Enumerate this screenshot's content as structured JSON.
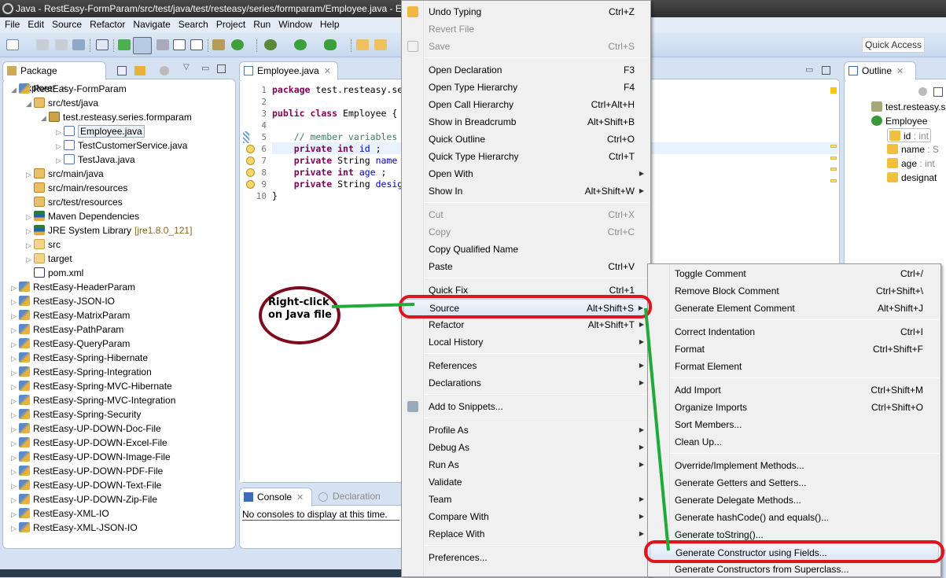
{
  "window": {
    "title": "Java - RestEasy-FormParam/src/test/java/test/resteasy/series/formparam/Employee.java - Eclipse"
  },
  "menubar": [
    "File",
    "Edit",
    "Source",
    "Refactor",
    "Navigate",
    "Search",
    "Project",
    "Run",
    "Window",
    "Help"
  ],
  "toolbar": {
    "quick_access_placeholder": "Quick Access"
  },
  "package_explorer": {
    "tab_label": "Package Explorer",
    "items": [
      {
        "label": "RestEasy-FormParam",
        "type": "project",
        "expanded": true
      },
      {
        "label": "src/test/java",
        "type": "source-folder",
        "expanded": true
      },
      {
        "label": "test.resteasy.series.formparam",
        "type": "package",
        "expanded": true
      },
      {
        "label": "Employee.java",
        "type": "java",
        "selected": true
      },
      {
        "label": "TestCustomerService.java",
        "type": "java"
      },
      {
        "label": "TestJava.java",
        "type": "java"
      },
      {
        "label": "src/main/java",
        "type": "source-folder"
      },
      {
        "label": "src/main/resources",
        "type": "source-folder"
      },
      {
        "label": "src/test/resources",
        "type": "source-folder"
      },
      {
        "label": "Maven Dependencies",
        "type": "library"
      },
      {
        "label": "JRE System Library",
        "suffix": "[jre1.8.0_121]",
        "type": "library"
      },
      {
        "label": "src",
        "type": "folder"
      },
      {
        "label": "target",
        "type": "folder"
      },
      {
        "label": "pom.xml",
        "type": "pom"
      },
      {
        "label": "RestEasy-HeaderParam",
        "type": "project"
      },
      {
        "label": "RestEasy-JSON-IO",
        "type": "project"
      },
      {
        "label": "RestEasy-MatrixParam",
        "type": "project"
      },
      {
        "label": "RestEasy-PathParam",
        "type": "project"
      },
      {
        "label": "RestEasy-QueryParam",
        "type": "project"
      },
      {
        "label": "RestEasy-Spring-Hibernate",
        "type": "project"
      },
      {
        "label": "RestEasy-Spring-Integration",
        "type": "project"
      },
      {
        "label": "RestEasy-Spring-MVC-Hibernate",
        "type": "project"
      },
      {
        "label": "RestEasy-Spring-MVC-Integration",
        "type": "project"
      },
      {
        "label": "RestEasy-Spring-Security",
        "type": "project"
      },
      {
        "label": "RestEasy-UP-DOWN-Doc-File",
        "type": "project"
      },
      {
        "label": "RestEasy-UP-DOWN-Excel-File",
        "type": "project"
      },
      {
        "label": "RestEasy-UP-DOWN-Image-File",
        "type": "project"
      },
      {
        "label": "RestEasy-UP-DOWN-PDF-File",
        "type": "project"
      },
      {
        "label": "RestEasy-UP-DOWN-Text-File",
        "type": "project"
      },
      {
        "label": "RestEasy-UP-DOWN-Zip-File",
        "type": "project"
      },
      {
        "label": "RestEasy-XML-IO",
        "type": "project"
      },
      {
        "label": "RestEasy-XML-JSON-IO",
        "type": "project"
      }
    ]
  },
  "editor": {
    "tab_label": "Employee.java",
    "lines": [
      {
        "n": "1",
        "parts": [
          [
            "kw",
            "package"
          ],
          [
            "",
            "test.resteasy.se"
          ]
        ]
      },
      {
        "n": "2",
        "parts": []
      },
      {
        "n": "3",
        "parts": [
          [
            "kw",
            "public"
          ],
          [
            "",
            ""
          ],
          [
            "kw",
            "class"
          ],
          [
            "",
            "Employee {"
          ]
        ]
      },
      {
        "n": "4",
        "parts": []
      },
      {
        "n": "5",
        "parts": [
          [
            "cm",
            "    // member variables"
          ]
        ]
      },
      {
        "n": "6",
        "parts": [
          [
            "kw",
            "    private"
          ],
          [
            "kw",
            "int"
          ],
          [
            "fld",
            "id"
          ],
          [
            "",
            ";"
          ]
        ]
      },
      {
        "n": "7",
        "parts": [
          [
            "kw",
            "    private"
          ],
          [
            "",
            "String"
          ],
          [
            "fld",
            "name"
          ]
        ]
      },
      {
        "n": "8",
        "parts": [
          [
            "kw",
            "    private"
          ],
          [
            "kw",
            "int"
          ],
          [
            "fld",
            "age"
          ],
          [
            "",
            ";"
          ]
        ]
      },
      {
        "n": "9",
        "parts": [
          [
            "kw",
            "    private"
          ],
          [
            "",
            "String"
          ],
          [
            "fld",
            "desig"
          ]
        ]
      },
      {
        "n": "10",
        "parts": [
          [
            "",
            "}"
          ]
        ]
      }
    ]
  },
  "outline": {
    "tab_label": "Outline",
    "items": [
      {
        "label": "test.resteasy.s",
        "type": "package"
      },
      {
        "label": "Employee",
        "type": "class"
      },
      {
        "label": "id",
        "typ": " : int",
        "selected": true
      },
      {
        "label": "name",
        "typ": " : S"
      },
      {
        "label": "age",
        "typ": " : int"
      },
      {
        "label": "designat",
        "typ": ""
      }
    ]
  },
  "console": {
    "tabs": [
      "Console",
      "Declaration"
    ],
    "message": "No consoles to display at this time."
  },
  "context_menu": {
    "items": [
      {
        "label": "Undo Typing",
        "shortcut": "Ctrl+Z",
        "icon": "undo-icon"
      },
      {
        "label": "Revert File",
        "shortcut": "",
        "disabled": true
      },
      {
        "label": "Save",
        "shortcut": "Ctrl+S",
        "disabled": true,
        "icon": "save-icon"
      },
      {
        "sep": true
      },
      {
        "label": "Open Declaration",
        "shortcut": "F3"
      },
      {
        "label": "Open Type Hierarchy",
        "shortcut": "F4"
      },
      {
        "label": "Open Call Hierarchy",
        "shortcut": "Ctrl+Alt+H"
      },
      {
        "label": "Show in Breadcrumb",
        "shortcut": "Alt+Shift+B"
      },
      {
        "label": "Quick Outline",
        "shortcut": "Ctrl+O"
      },
      {
        "label": "Quick Type Hierarchy",
        "shortcut": "Ctrl+T"
      },
      {
        "label": "Open With",
        "shortcut": "",
        "submenu": true
      },
      {
        "label": "Show In",
        "shortcut": "Alt+Shift+W",
        "submenu": true
      },
      {
        "sep": true
      },
      {
        "label": "Cut",
        "shortcut": "Ctrl+X",
        "disabled": true
      },
      {
        "label": "Copy",
        "shortcut": "Ctrl+C",
        "disabled": true
      },
      {
        "label": "Copy Qualified Name",
        "shortcut": ""
      },
      {
        "label": "Paste",
        "shortcut": "Ctrl+V"
      },
      {
        "sep": true
      },
      {
        "label": "Quick Fix",
        "shortcut": "Ctrl+1"
      },
      {
        "label": "Source",
        "shortcut": "Alt+Shift+S",
        "submenu": true,
        "highlighted": true
      },
      {
        "label": "Refactor",
        "shortcut": "Alt+Shift+T",
        "submenu": true
      },
      {
        "label": "Local History",
        "shortcut": "",
        "submenu": true
      },
      {
        "sep": true
      },
      {
        "label": "References",
        "shortcut": "",
        "submenu": true
      },
      {
        "label": "Declarations",
        "shortcut": "",
        "submenu": true
      },
      {
        "sep": true
      },
      {
        "label": "Add to Snippets...",
        "shortcut": "",
        "icon": "snippets-icon"
      },
      {
        "sep": true
      },
      {
        "label": "Profile As",
        "shortcut": "",
        "submenu": true
      },
      {
        "label": "Debug As",
        "shortcut": "",
        "submenu": true
      },
      {
        "label": "Run As",
        "shortcut": "",
        "submenu": true
      },
      {
        "label": "Validate",
        "shortcut": ""
      },
      {
        "label": "Team",
        "shortcut": "",
        "submenu": true
      },
      {
        "label": "Compare With",
        "shortcut": "",
        "submenu": true
      },
      {
        "label": "Replace With",
        "shortcut": "",
        "submenu": true
      },
      {
        "sep": true
      },
      {
        "label": "Preferences...",
        "shortcut": ""
      }
    ]
  },
  "source_submenu": {
    "items": [
      {
        "label": "Toggle Comment",
        "shortcut": "Ctrl+/"
      },
      {
        "label": "Remove Block Comment",
        "shortcut": "Ctrl+Shift+\\"
      },
      {
        "label": "Generate Element Comment",
        "shortcut": "Alt+Shift+J"
      },
      {
        "sep": true
      },
      {
        "label": "Correct Indentation",
        "shortcut": "Ctrl+I"
      },
      {
        "label": "Format",
        "shortcut": "Ctrl+Shift+F"
      },
      {
        "label": "Format Element",
        "shortcut": ""
      },
      {
        "sep": true
      },
      {
        "label": "Add Import",
        "shortcut": "Ctrl+Shift+M"
      },
      {
        "label": "Organize Imports",
        "shortcut": "Ctrl+Shift+O"
      },
      {
        "label": "Sort Members...",
        "shortcut": ""
      },
      {
        "label": "Clean Up...",
        "shortcut": ""
      },
      {
        "sep": true
      },
      {
        "label": "Override/Implement Methods...",
        "shortcut": ""
      },
      {
        "label": "Generate Getters and Setters...",
        "shortcut": ""
      },
      {
        "label": "Generate Delegate Methods...",
        "shortcut": ""
      },
      {
        "label": "Generate hashCode() and equals()...",
        "shortcut": ""
      },
      {
        "label": "Generate toString()...",
        "shortcut": ""
      },
      {
        "label": "Generate Constructor using Fields...",
        "shortcut": "",
        "highlighted": true
      },
      {
        "label": "Generate Constructors from Superclass...",
        "shortcut": ""
      }
    ]
  },
  "annotation": {
    "text_line1": "Right-click",
    "text_line2": "on Java file",
    "circle_color": "#7d0a1e",
    "ring_color": "#e0141c",
    "arrow_color": "#1faa3a"
  }
}
